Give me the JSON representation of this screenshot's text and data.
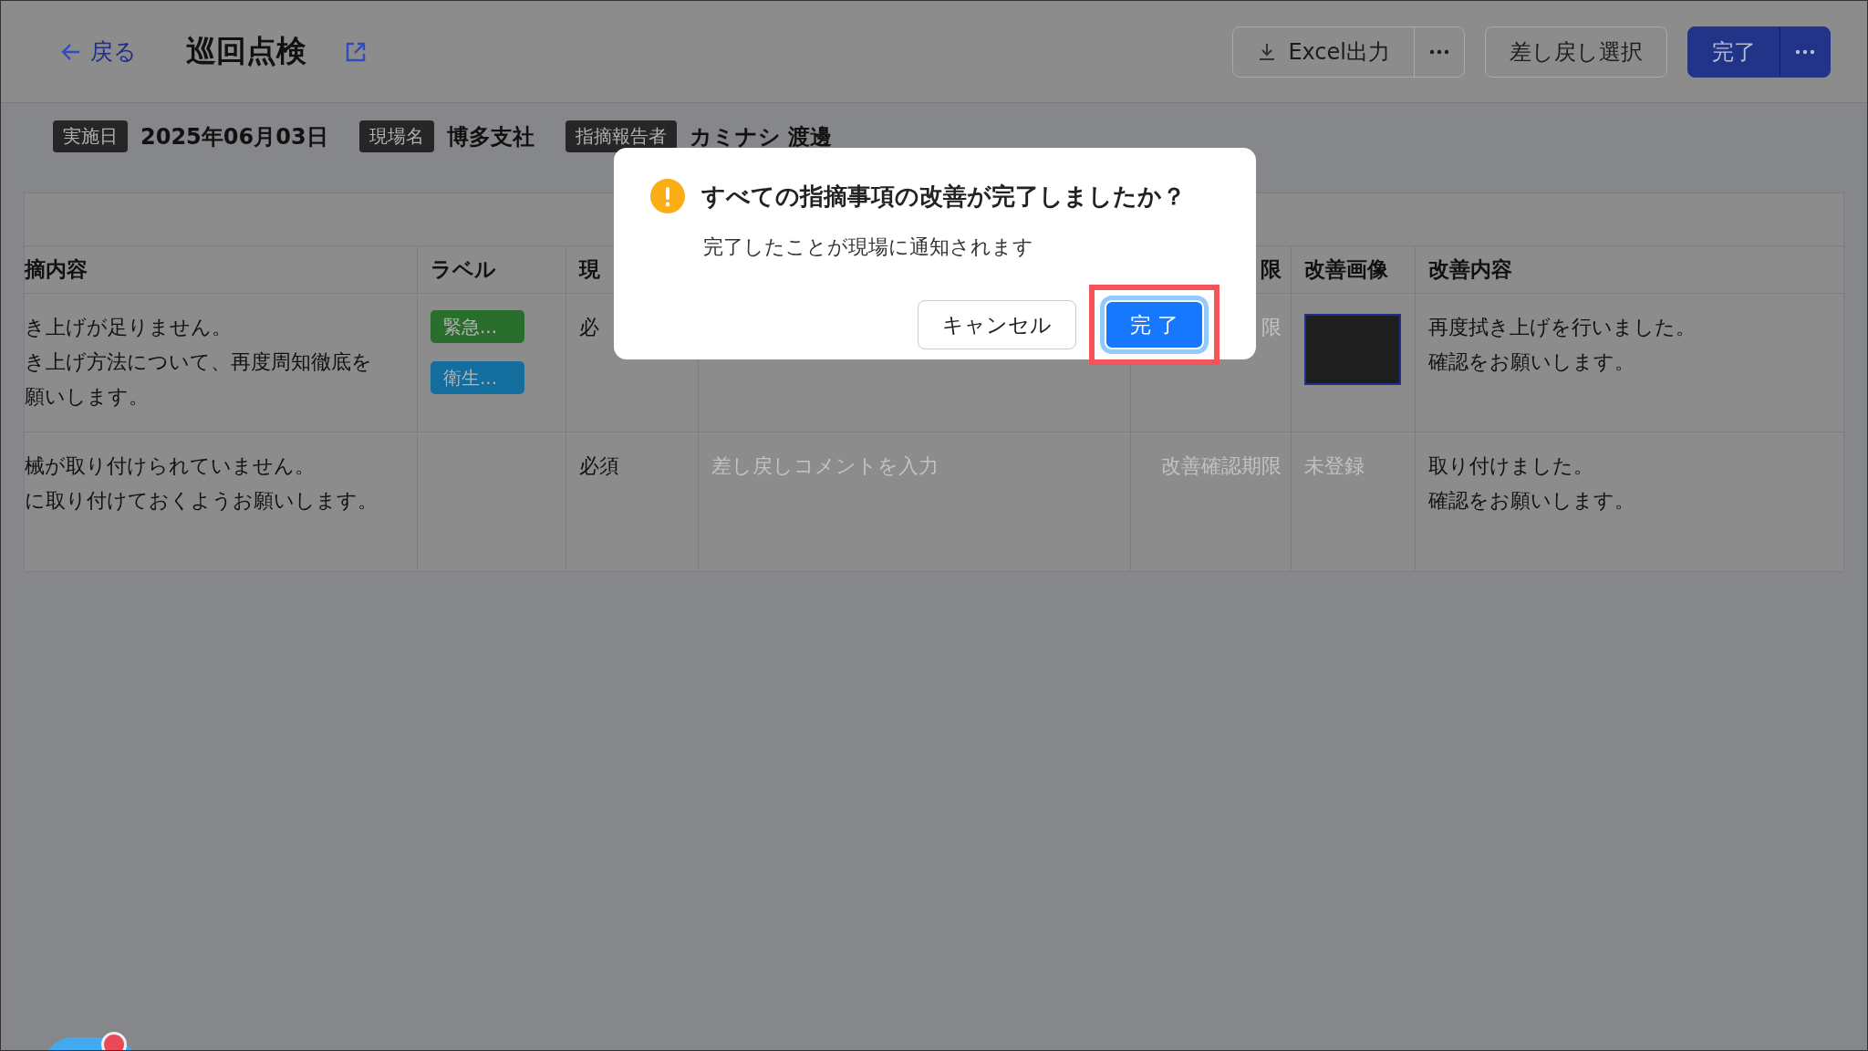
{
  "header": {
    "back_label": "戻る",
    "title": "巡回点検",
    "buttons": [
      {
        "kind": "export",
        "label": "Excel出力"
      },
      {
        "kind": "more"
      },
      {
        "kind": "outline",
        "label": "差し戻し選択"
      },
      {
        "kind": "primary",
        "label": "完了"
      },
      {
        "kind": "primary-more"
      }
    ]
  },
  "info": [
    {
      "label": "実施日",
      "value": "2025年06月03日"
    },
    {
      "label": "現場名",
      "value": "博多支社"
    },
    {
      "label": "指摘報告者",
      "value": "カミナシ 渡邊"
    }
  ],
  "table": {
    "columns": [
      {
        "label": "摘内容"
      },
      {
        "label": "ラベル"
      },
      {
        "label": "現"
      },
      {},
      {
        "label": "限"
      },
      {
        "label": "改善画像"
      },
      {
        "label": "改善内容"
      }
    ],
    "rows": [
      {
        "cells": [
          {
            "kind": "text",
            "lines": [
              "き上げが足りません。",
              "き上げ方法について、再度周知徹底を",
              "願いします。"
            ]
          },
          {
            "kind": "tags",
            "tags": [
              {
                "text": "緊急...",
                "color": "#2a6e2e"
              },
              {
                "text": "衛生...",
                "color": "#136e9e"
              }
            ]
          },
          {
            "kind": "text",
            "lines": [
              "必"
            ]
          },
          {
            "kind": "hidden"
          },
          {
            "kind": "muted",
            "text": "限"
          },
          {
            "kind": "photo"
          },
          {
            "kind": "text",
            "lines": [
              "再度拭き上げを行いました。",
              "確認をお願いします。"
            ]
          }
        ]
      },
      {
        "cells": [
          {
            "kind": "text",
            "lines": [
              "械が取り付けられていません。",
              "に取り付けておくようお願いします。"
            ]
          },
          {
            "kind": "blank"
          },
          {
            "kind": "text",
            "lines": [
              "必須"
            ]
          },
          {
            "kind": "input",
            "placeholder": "差し戻しコメントを入力"
          },
          {
            "kind": "muted",
            "text": "改善確認期限"
          },
          {
            "kind": "muted",
            "text": "未登録"
          },
          {
            "kind": "text",
            "lines": [
              "取り付けました。",
              "確認をお願いします。"
            ]
          }
        ]
      }
    ]
  },
  "dialog": {
    "title": "すべての指摘事項の改善が完了しましたか？",
    "message": "完了したことが現場に通知されます",
    "buttons": [
      {
        "kind": "cancel",
        "label": "キャンセル",
        "highlighted": false
      },
      {
        "kind": "ok",
        "label": "完 了",
        "highlighted": true
      }
    ]
  }
}
